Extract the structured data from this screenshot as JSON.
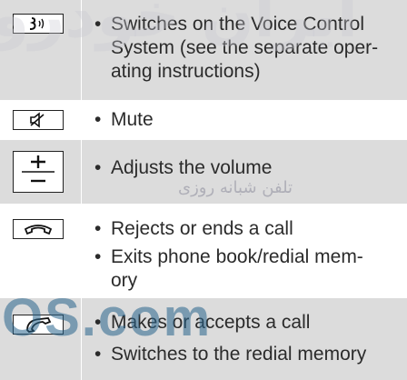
{
  "rows": [
    {
      "key_icon": "voice-control-icon",
      "bullets": [
        {
          "lines": [
            "Switches on the Voice Control",
            "System (see the separate oper-",
            "ating instructions)"
          ]
        }
      ]
    },
    {
      "key_icon": "mute-icon",
      "bullets": [
        {
          "lines": [
            "Mute"
          ]
        }
      ]
    },
    {
      "key_icon": "volume-plus-minus-icon",
      "bullets": [
        {
          "lines": [
            "Adjusts the volume"
          ]
        }
      ]
    },
    {
      "key_icon": "end-call-icon",
      "bullets": [
        {
          "lines": [
            "Rejects or ends a call"
          ]
        },
        {
          "lines": [
            "Exits phone book/redial mem-",
            "ory"
          ]
        }
      ]
    },
    {
      "key_icon": "accept-call-icon",
      "bullets": [
        {
          "lines": [
            "Makes or accepts a call"
          ]
        },
        {
          "lines": [
            "Switches to the redial memory"
          ]
        }
      ]
    }
  ],
  "bullet_char": "•",
  "watermark": {
    "top": "ايران خودرو",
    "middle": "تلفن شبانه روزی",
    "bottom": "OS.com"
  },
  "colors": {
    "shaded_row": "#dcdcdc",
    "text": "#2b2b2b"
  }
}
